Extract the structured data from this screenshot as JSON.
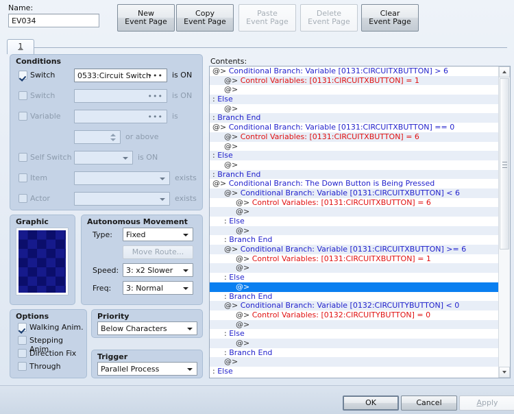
{
  "header": {
    "name_label": "Name:",
    "name_value": "EV034",
    "page_buttons": [
      {
        "l1": "New",
        "l2": "Event Page",
        "enabled": true,
        "name": "new-event-page-button"
      },
      {
        "l1": "Copy",
        "l2": "Event Page",
        "enabled": true,
        "name": "copy-event-page-button"
      },
      {
        "l1": "Paste",
        "l2": "Event Page",
        "enabled": false,
        "name": "paste-event-page-button"
      },
      {
        "l1": "Delete",
        "l2": "Event Page",
        "enabled": false,
        "name": "delete-event-page-button"
      },
      {
        "l1": "Clear",
        "l2": "Event Page",
        "enabled": true,
        "name": "clear-event-page-button"
      }
    ]
  },
  "tabs": [
    {
      "label": "1",
      "selected": true
    }
  ],
  "conditions": {
    "title": "Conditions",
    "rows": [
      {
        "label": "Switch",
        "checked": true,
        "value": "0533:Circuit Switch",
        "suffix": "is ON",
        "kind": "picker"
      },
      {
        "label": "Switch",
        "checked": false,
        "value": "",
        "suffix": "is ON",
        "kind": "picker"
      },
      {
        "label": "Variable",
        "checked": false,
        "value": "",
        "suffix": "is",
        "kind": "picker"
      },
      {
        "label": "",
        "checked": null,
        "value": "",
        "suffix": "or above",
        "kind": "spinner"
      },
      {
        "label": "Self Switch",
        "checked": false,
        "value": "",
        "suffix": "is ON",
        "kind": "combo-small"
      },
      {
        "label": "Item",
        "checked": false,
        "value": "",
        "suffix": "exists",
        "kind": "combo"
      },
      {
        "label": "Actor",
        "checked": false,
        "value": "",
        "suffix": "exists",
        "kind": "combo"
      }
    ]
  },
  "graphic": {
    "title": "Graphic",
    "colors": [
      "#161a8c",
      "#0b0e6b"
    ]
  },
  "movement": {
    "title": "Autonomous Movement",
    "type_label": "Type:",
    "type_value": "Fixed",
    "move_route_label": "Move Route...",
    "speed_label": "Speed:",
    "speed_value": "3: x2 Slower",
    "freq_label": "Freq:",
    "freq_value": "3: Normal"
  },
  "options": {
    "title": "Options",
    "items": [
      {
        "label": "Walking Anim.",
        "checked": true
      },
      {
        "label": "Stepping Anim.",
        "checked": false
      },
      {
        "label": "Direction Fix",
        "checked": false
      },
      {
        "label": "Through",
        "checked": false
      }
    ]
  },
  "priority": {
    "title": "Priority",
    "value": "Below Characters"
  },
  "trigger": {
    "title": "Trigger",
    "value": "Parallel Process"
  },
  "contents": {
    "label": "Contents:",
    "selected_index": 23,
    "lines": [
      {
        "indent": 0,
        "marker": "@>",
        "text": "Conditional Branch: Variable [0131:CIRCUITXBUTTON] > 6",
        "color": "blue"
      },
      {
        "indent": 1,
        "marker": "@>",
        "text": "Control Variables: [0131:CIRCUITXBUTTON] = 1",
        "color": "red"
      },
      {
        "indent": 1,
        "marker": "@>",
        "text": "",
        "color": "blue"
      },
      {
        "indent": 0,
        "marker": ":",
        "text": "Else",
        "color": "blue"
      },
      {
        "indent": 1,
        "marker": "@>",
        "text": "",
        "color": "blue"
      },
      {
        "indent": 0,
        "marker": ":",
        "text": "Branch End",
        "color": "blue"
      },
      {
        "indent": 0,
        "marker": "@>",
        "text": "Conditional Branch: Variable [0131:CIRCUITXBUTTON] == 0",
        "color": "blue"
      },
      {
        "indent": 1,
        "marker": "@>",
        "text": "Control Variables: [0131:CIRCUITXBUTTON] = 6",
        "color": "red"
      },
      {
        "indent": 1,
        "marker": "@>",
        "text": "",
        "color": "blue"
      },
      {
        "indent": 0,
        "marker": ":",
        "text": "Else",
        "color": "blue"
      },
      {
        "indent": 1,
        "marker": "@>",
        "text": "",
        "color": "blue"
      },
      {
        "indent": 0,
        "marker": ":",
        "text": "Branch End",
        "color": "blue"
      },
      {
        "indent": 0,
        "marker": "@>",
        "text": "Conditional Branch: The Down Button is Being Pressed",
        "color": "blue"
      },
      {
        "indent": 1,
        "marker": "@>",
        "text": "Conditional Branch: Variable [0131:CIRCUITXBUTTON] < 6",
        "color": "blue"
      },
      {
        "indent": 2,
        "marker": "@>",
        "text": "Control Variables: [0131:CIRCUITXBUTTON] = 6",
        "color": "red"
      },
      {
        "indent": 2,
        "marker": "@>",
        "text": "",
        "color": "blue"
      },
      {
        "indent": 1,
        "marker": ":",
        "text": "Else",
        "color": "blue"
      },
      {
        "indent": 2,
        "marker": "@>",
        "text": "",
        "color": "blue"
      },
      {
        "indent": 1,
        "marker": ":",
        "text": "Branch End",
        "color": "blue"
      },
      {
        "indent": 1,
        "marker": "@>",
        "text": "Conditional Branch: Variable [0131:CIRCUITXBUTTON] >= 6",
        "color": "blue"
      },
      {
        "indent": 2,
        "marker": "@>",
        "text": "Control Variables: [0131:CIRCUITXBUTTON] = 1",
        "color": "red"
      },
      {
        "indent": 2,
        "marker": "@>",
        "text": "",
        "color": "blue"
      },
      {
        "indent": 1,
        "marker": ":",
        "text": "Else",
        "color": "blue"
      },
      {
        "indent": 2,
        "marker": "@>",
        "text": "",
        "color": "blue"
      },
      {
        "indent": 1,
        "marker": ":",
        "text": "Branch End",
        "color": "blue"
      },
      {
        "indent": 1,
        "marker": "@>",
        "text": "Conditional Branch: Variable [0132:CIRCUITYBUTTON] < 0",
        "color": "blue"
      },
      {
        "indent": 2,
        "marker": "@>",
        "text": "Control Variables: [0132:CIRCUITYBUTTON] = 0",
        "color": "red"
      },
      {
        "indent": 2,
        "marker": "@>",
        "text": "",
        "color": "blue"
      },
      {
        "indent": 1,
        "marker": ":",
        "text": "Else",
        "color": "blue"
      },
      {
        "indent": 2,
        "marker": "@>",
        "text": "",
        "color": "blue"
      },
      {
        "indent": 1,
        "marker": ":",
        "text": "Branch End",
        "color": "blue"
      },
      {
        "indent": 1,
        "marker": "@>",
        "text": "",
        "color": "blue"
      },
      {
        "indent": 0,
        "marker": ":",
        "text": "Else",
        "color": "blue"
      }
    ]
  },
  "footer": {
    "ok": "OK",
    "cancel": "Cancel",
    "apply_prefix": "A",
    "apply_rest": "pply"
  }
}
